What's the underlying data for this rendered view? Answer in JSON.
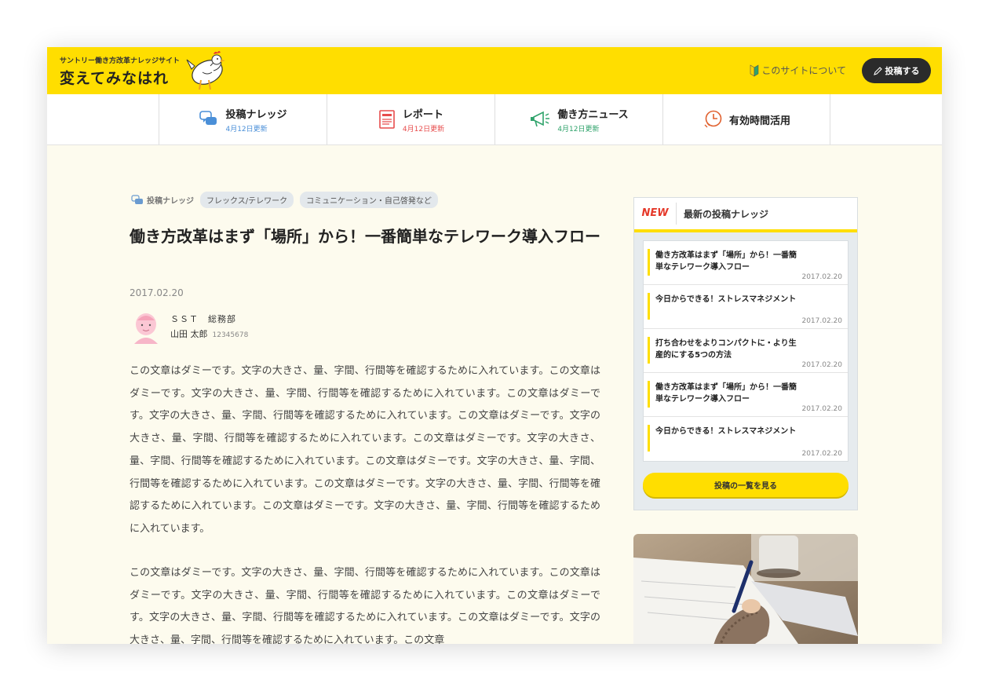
{
  "header": {
    "site_subtitle": "サントリー働き方改革ナレッジサイト",
    "site_title": "変えてみなはれ",
    "about_link": "このサイトについて",
    "post_button": "投稿する"
  },
  "nav": [
    {
      "label": "投稿ナレッジ",
      "date": "4月12日更新",
      "color": "#4a8fd8",
      "icon": "chat-bubbles-icon"
    },
    {
      "label": "レポート",
      "date": "4月12日更新",
      "color": "#e74c4c",
      "icon": "document-icon"
    },
    {
      "label": "働き方ニュース",
      "date": "4月12日更新",
      "color": "#2fa36b",
      "icon": "megaphone-icon"
    },
    {
      "label": "有効時間活用",
      "date": "",
      "color": "#e0602e",
      "icon": "clock-icon"
    }
  ],
  "article": {
    "category": "投稿ナレッジ",
    "tags": [
      "フレックス/テレワーク",
      "コミュニケーション・自己啓発など"
    ],
    "title": "働き方改革はまず「場所」から！一番簡単なテレワーク導入フロー",
    "date": "2017.02.20",
    "department": "ＳＳＴ　総務部",
    "author": "山田 太郎",
    "author_id": "12345678",
    "paragraph1": "この文章はダミーです。文字の大きさ、量、字間、行間等を確認するために入れています。この文章はダミーです。文字の大きさ、量、字間、行間等を確認するために入れています。この文章はダミーです。文字の大きさ、量、字間、行間等を確認するために入れています。この文章はダミーです。文字の大きさ、量、字間、行間等を確認するために入れています。この文章はダミーです。文字の大きさ、量、字間、行間等を確認するために入れています。この文章はダミーです。文字の大きさ、量、字間、行間等を確認するために入れています。この文章はダミーです。文字の大きさ、量、字間、行間等を確認するために入れています。この文章はダミーです。文字の大きさ、量、字間、行間等を確認するために入れています。",
    "paragraph2": "この文章はダミーです。文字の大きさ、量、字間、行間等を確認するために入れています。この文章はダミーです。文字の大きさ、量、字間、行間等を確認するために入れています。この文章はダミーです。文字の大きさ、量、字間、行間等を確認するために入れています。この文章はダミーです。文字の大きさ、量、字間、行間等を確認するために入れています。この文章"
  },
  "sidebar": {
    "badge": "NEW",
    "title": "最新の投稿ナレッジ",
    "items": [
      {
        "title": "働き方改革はまず「場所」から！一番簡単なテレワーク導入フロー",
        "date": "2017.02.20"
      },
      {
        "title": "今日からできる！ストレスマネジメント",
        "date": "2017.02.20"
      },
      {
        "title": "打ち合わせをよりコンパクトに・より生産的にする5つの方法",
        "date": "2017.02.20"
      },
      {
        "title": "働き方改革はまず「場所」から！一番簡単なテレワーク導入フロー",
        "date": "2017.02.20"
      },
      {
        "title": "今日からできる！ストレスマネジメント",
        "date": "2017.02.20"
      }
    ],
    "more_button": "投稿の一覧を見る"
  },
  "colors": {
    "brand_yellow": "#ffde00",
    "background": "#fdfbee",
    "dark_button": "#2b2b2b"
  }
}
